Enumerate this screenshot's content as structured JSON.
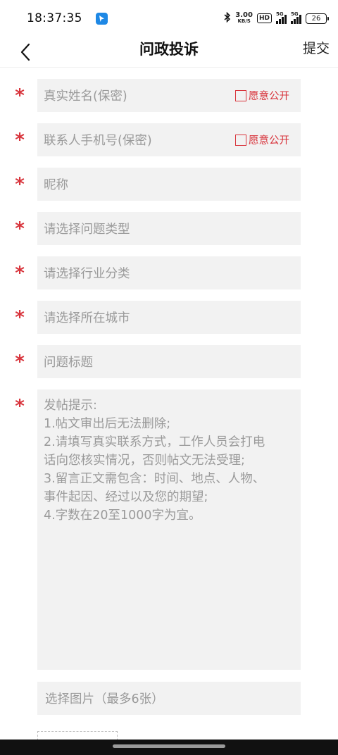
{
  "status_bar": {
    "time": "18:37:35",
    "net_speed_value": "3.00",
    "net_speed_unit": "KB/S",
    "hd_label": "HD",
    "signal1_label": "5G",
    "signal2_label": "5G",
    "battery": "26"
  },
  "nav": {
    "title": "问政投诉",
    "submit_label": "提交"
  },
  "form": {
    "required_mark": "*",
    "name_placeholder": "真实姓名(保密)",
    "name_public_label": "愿意公开",
    "phone_placeholder": "联系人手机号(保密)",
    "phone_public_label": "愿意公开",
    "nickname_placeholder": "昵称",
    "problem_type_placeholder": "请选择问题类型",
    "industry_placeholder": "请选择行业分类",
    "city_placeholder": "请选择所在城市",
    "title_placeholder": "问题标题",
    "content_hint_lines": [
      "发帖提示:",
      "1.帖文审出后无法删除;",
      "2.请填写真实联系方式，工作人员会打电",
      "话向您核实情况，否则帖文无法受理;",
      "3.留言正文需包含：时间、地点、人物、",
      "事件起因、经过以及您的期望;",
      "4.字数在20至1000字为宜。"
    ],
    "image_placeholder": "选择图片（最多6张）"
  },
  "colors": {
    "accent_red": "#d8343c",
    "field_bg": "#f2f2f2",
    "placeholder": "#9a9a9a"
  }
}
